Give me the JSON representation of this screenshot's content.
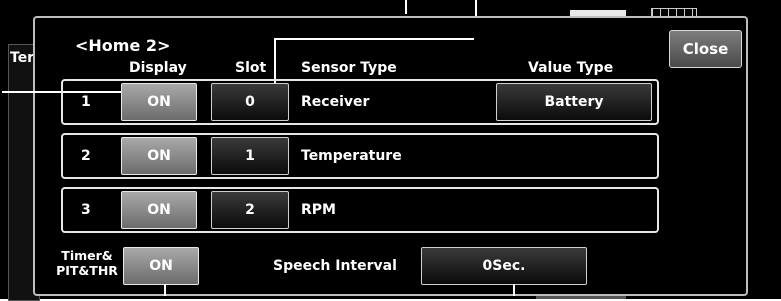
{
  "background": {
    "left_tab_text": "Ter"
  },
  "dialog": {
    "title": "<Home 2>",
    "close_label": "Close",
    "headers": {
      "display": "Display",
      "slot": "Slot",
      "sensor_type": "Sensor Type",
      "value_type": "Value Type"
    },
    "rows": [
      {
        "index": "1",
        "display": "ON",
        "slot": "0",
        "sensor_type": "Receiver",
        "value_type": "Battery"
      },
      {
        "index": "2",
        "display": "ON",
        "slot": "1",
        "sensor_type": "Temperature"
      },
      {
        "index": "3",
        "display": "ON",
        "slot": "2",
        "sensor_type": "RPM"
      }
    ],
    "timer": {
      "label_line1": "Timer&",
      "label_line2": "PIT&THR",
      "value": "ON"
    },
    "speech": {
      "label": "Speech Interval",
      "value": "0Sec."
    }
  },
  "colors": {
    "dialog_bg": "#000000",
    "on_button": "#8a8a8a",
    "dark_button": "#1e1e1e",
    "border": "#e6e6e6"
  }
}
